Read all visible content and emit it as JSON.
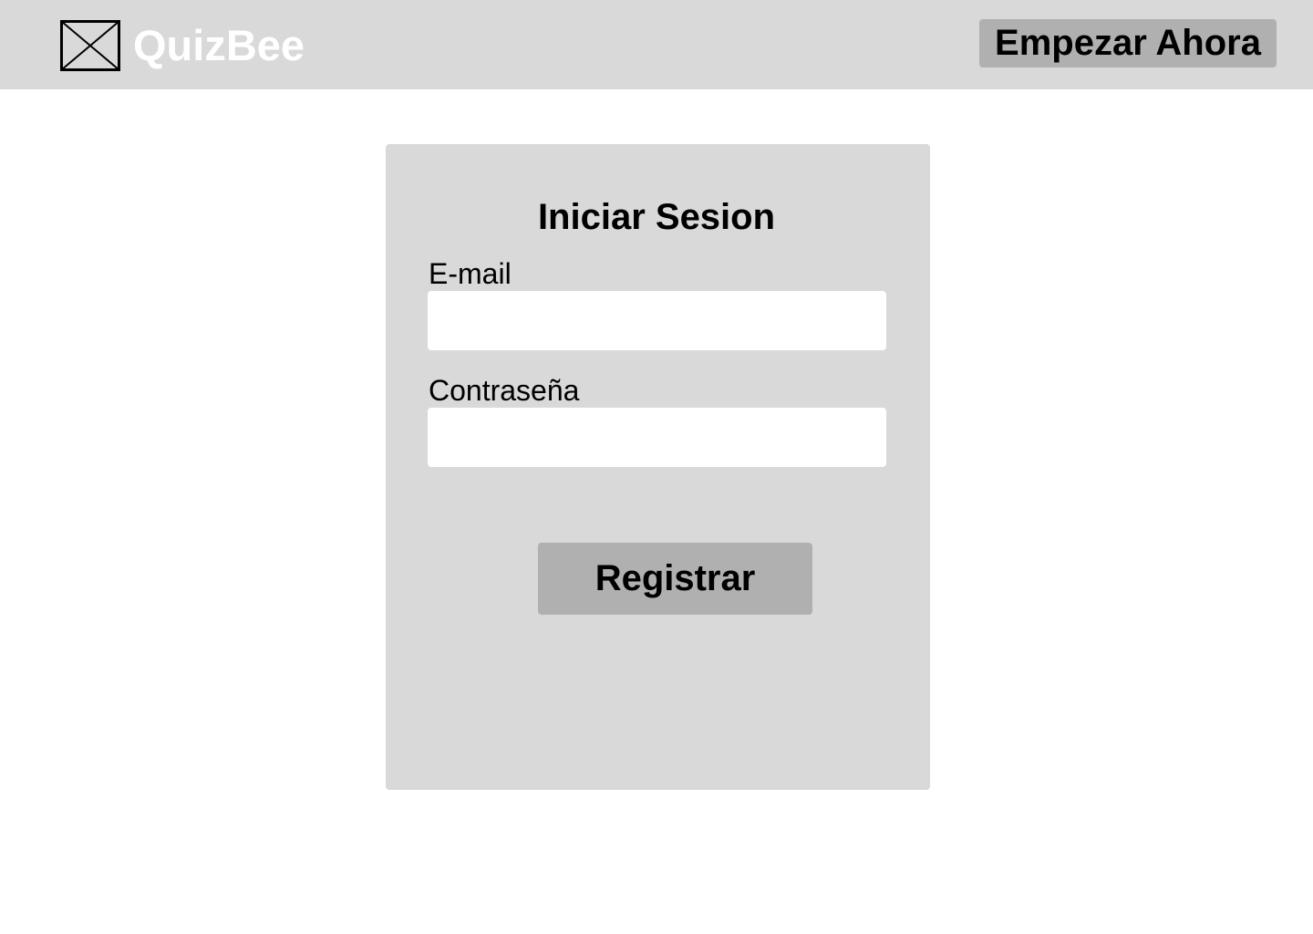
{
  "header": {
    "brand_name": "QuizBee",
    "logo_icon": "image-placeholder-icon",
    "cta_label": "Empezar Ahora"
  },
  "login": {
    "title": "Iniciar Sesion",
    "email_label": "E-mail",
    "email_value": "",
    "email_placeholder": "",
    "password_label": "Contraseña",
    "password_value": "",
    "password_placeholder": "",
    "submit_label": "Registrar"
  },
  "colors": {
    "header_background": "#d9d9d9",
    "card_background": "#d9d9d9",
    "button_background": "#b0b0b0",
    "brand_text": "#ffffff",
    "input_background": "#ffffff"
  }
}
